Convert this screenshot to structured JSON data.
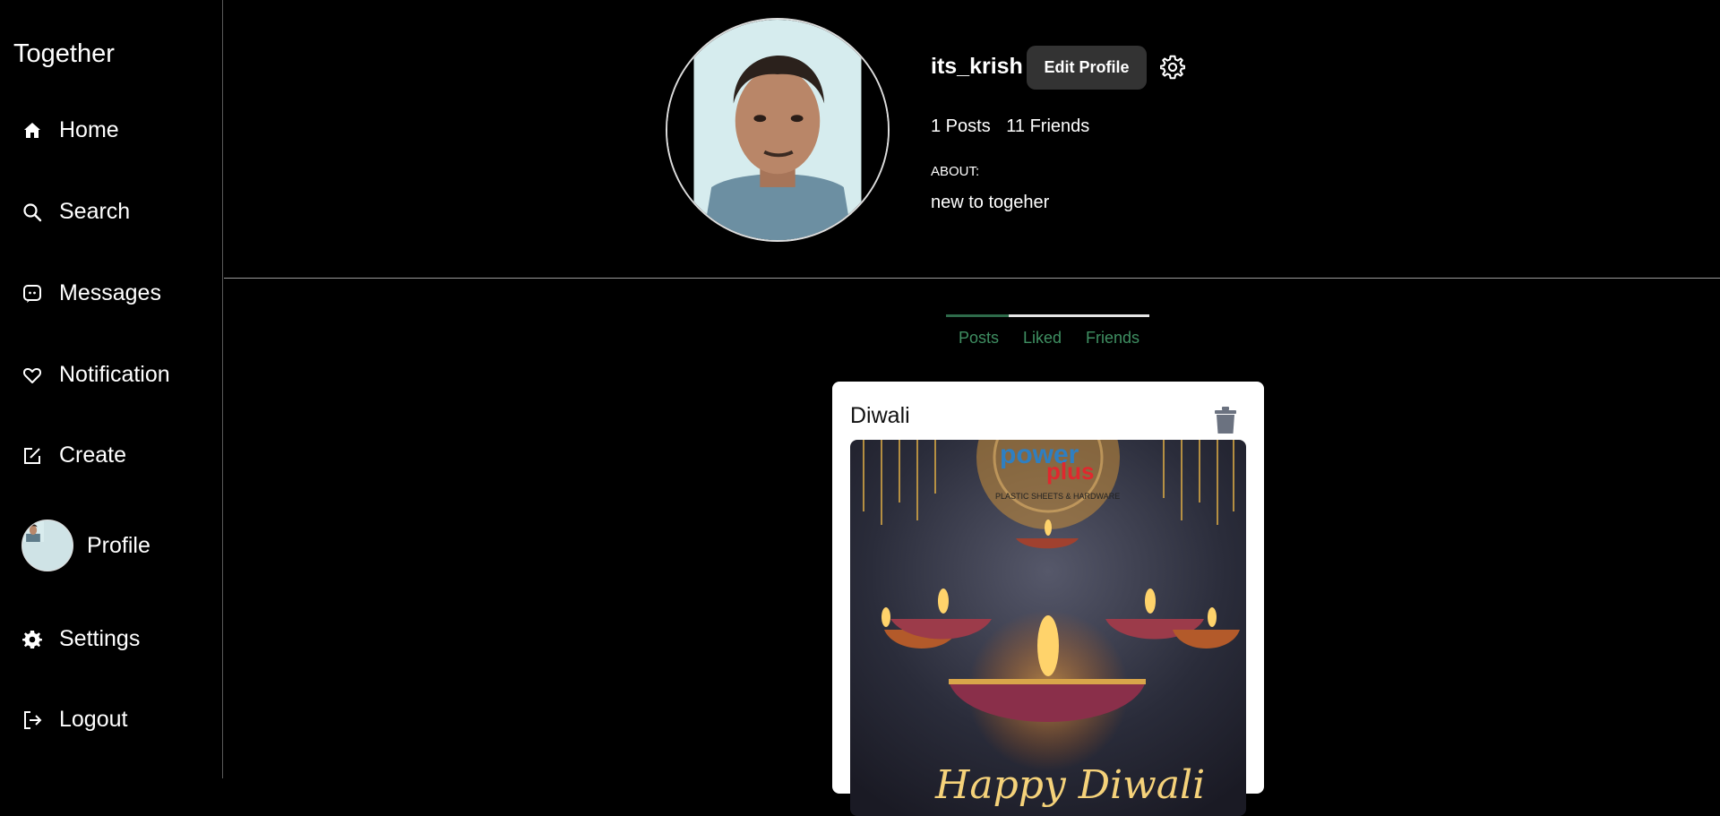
{
  "app": {
    "brand": "Together"
  },
  "sidebar": {
    "items": [
      {
        "label": "Home",
        "icon": "home-icon"
      },
      {
        "label": "Search",
        "icon": "search-icon"
      },
      {
        "label": "Messages",
        "icon": "messages-icon"
      },
      {
        "label": "Notification",
        "icon": "heart-icon"
      },
      {
        "label": "Create",
        "icon": "create-icon"
      },
      {
        "label": "Profile",
        "icon": "avatar"
      },
      {
        "label": "Settings",
        "icon": "gear-icon"
      },
      {
        "label": "Logout",
        "icon": "logout-icon"
      }
    ]
  },
  "profile": {
    "username": "its_krish",
    "edit_label": "Edit Profile",
    "posts": "1 Posts",
    "friends": "11 Friends",
    "about_label": "ABOUT:",
    "about_text": "new to togeher"
  },
  "tabs": {
    "items": [
      "Posts",
      "Liked",
      "Friends"
    ],
    "active": "Posts"
  },
  "post": {
    "title": "Diwali",
    "image": {
      "brand_primary": "power",
      "brand_secondary": "plus",
      "brand_tagline": "PLASTIC SHEETS & HARDWARE",
      "greeting": "Happy Diwali"
    }
  },
  "colors": {
    "background": "#000000",
    "accent_tab": "#3f8f62",
    "button_bg": "#333333",
    "card_bg": "#ffffff"
  }
}
